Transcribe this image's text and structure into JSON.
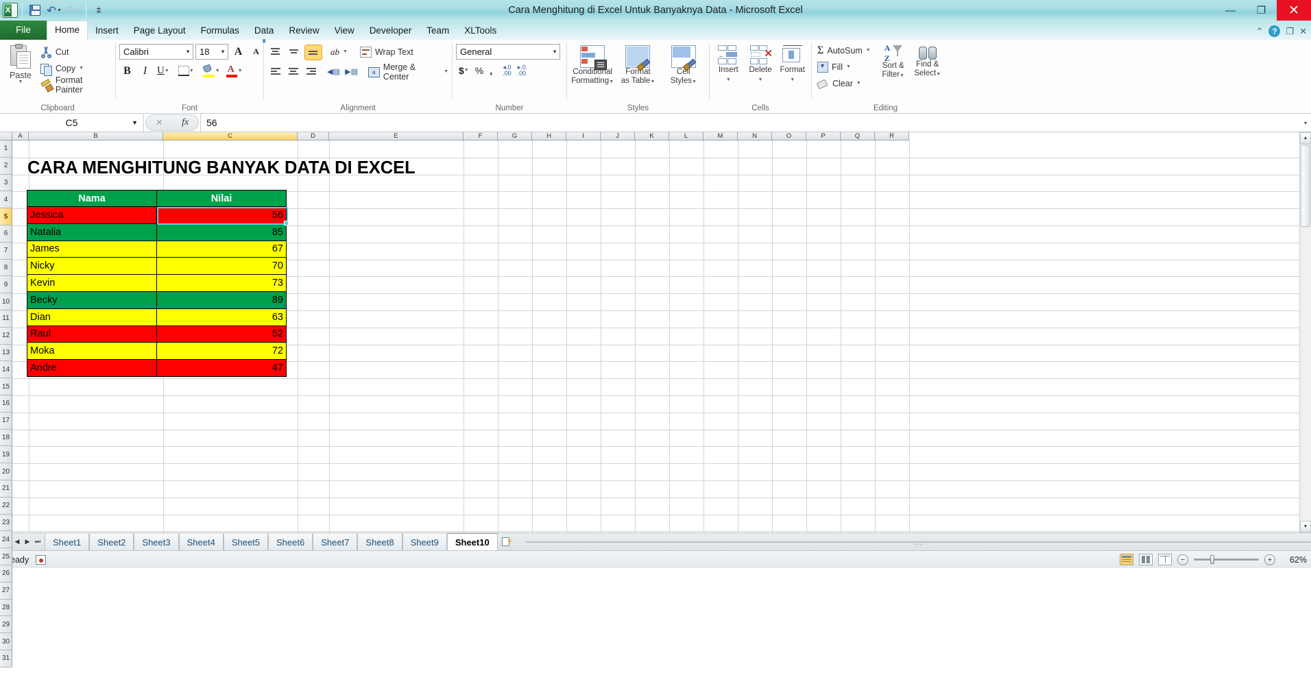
{
  "window": {
    "title": "Cara Menghitung di Excel Untuk Banyaknya Data - Microsoft Excel",
    "minimize": "—",
    "restore": "❐",
    "close": "✕"
  },
  "quick_access": {
    "logo": "excel-logo-icon",
    "save": "save-icon",
    "undo": "undo-icon",
    "redo": "redo-icon",
    "customize": "customize-qat-icon"
  },
  "ribbon_tabs": [
    {
      "label": "File",
      "active": false,
      "is_file": true
    },
    {
      "label": "Home",
      "active": true,
      "is_file": false
    },
    {
      "label": "Insert",
      "active": false,
      "is_file": false
    },
    {
      "label": "Page Layout",
      "active": false,
      "is_file": false
    },
    {
      "label": "Formulas",
      "active": false,
      "is_file": false
    },
    {
      "label": "Data",
      "active": false,
      "is_file": false
    },
    {
      "label": "Review",
      "active": false,
      "is_file": false
    },
    {
      "label": "View",
      "active": false,
      "is_file": false
    },
    {
      "label": "Developer",
      "active": false,
      "is_file": false
    },
    {
      "label": "Team",
      "active": false,
      "is_file": false
    },
    {
      "label": "XLTools",
      "active": false,
      "is_file": false
    }
  ],
  "ribbon_right": {
    "minimize_ribbon": "⌃",
    "help": "?",
    "restore_window": "❐",
    "close_window": "✕"
  },
  "ribbon": {
    "clipboard": {
      "label": "Clipboard",
      "paste": "Paste",
      "cut": "Cut",
      "copy": "Copy",
      "format_painter": "Format Painter"
    },
    "font": {
      "label": "Font",
      "font_name": "Calibri",
      "font_size": "18",
      "grow_font": "A",
      "shrink_font": "A",
      "bold": "B",
      "italic": "I",
      "underline": "U",
      "fill_color": "fill-color-icon",
      "font_color": "font-color-icon",
      "borders": "borders-icon"
    },
    "alignment": {
      "label": "Alignment",
      "wrap_text": "Wrap Text",
      "merge_center": "Merge & Center",
      "orientation": "orientation-icon"
    },
    "number": {
      "label": "Number",
      "format": "General",
      "currency": "$",
      "percent": "%",
      "comma": ",",
      "increase_decimal": ".00",
      "decrease_decimal": ".00"
    },
    "styles": {
      "label": "Styles",
      "conditional_formatting": "Conditional\nFormatting",
      "conditional_formatting_l1": "Conditional",
      "conditional_formatting_l2": "Formatting",
      "format_as_table_l1": "Format",
      "format_as_table_l2": "as Table",
      "cell_styles_l1": "Cell",
      "cell_styles_l2": "Styles"
    },
    "cells": {
      "label": "Cells",
      "insert": "Insert",
      "delete": "Delete",
      "format": "Format"
    },
    "editing": {
      "label": "Editing",
      "autosum": "AutoSum",
      "fill": "Fill",
      "clear": "Clear",
      "sort_filter_l1": "Sort &",
      "sort_filter_l2": "Filter",
      "find_select_l1": "Find &",
      "find_select_l2": "Select"
    }
  },
  "formula_bar": {
    "name_box": "C5",
    "cancel": "✕",
    "enter": "✓",
    "insert_function": "fx",
    "value": "56",
    "expand": "▾"
  },
  "grid": {
    "column_headers": [
      "A",
      "B",
      "C",
      "D",
      "E",
      "F",
      "G",
      "H",
      "I",
      "J",
      "K",
      "L",
      "M",
      "N",
      "O",
      "P",
      "Q",
      "R"
    ],
    "selected_column": "C",
    "row_headers": [
      "1",
      "2",
      "3",
      "4",
      "5",
      "6",
      "7",
      "8",
      "9",
      "10",
      "11",
      "12",
      "13",
      "14",
      "15",
      "16",
      "17",
      "18",
      "19",
      "20",
      "21",
      "22",
      "23",
      "24",
      "25",
      "26",
      "27",
      "28",
      "29",
      "30",
      "31"
    ],
    "selected_row": "5",
    "sheet_title": "CARA MENGHITUNG BANYAK DATA DI EXCEL",
    "table": {
      "headers": [
        "Nama",
        "Nilai"
      ],
      "rows": [
        {
          "name": "Jessica",
          "value": "56",
          "color": "red"
        },
        {
          "name": "Natalia",
          "value": "85",
          "color": "green"
        },
        {
          "name": "James",
          "value": "67",
          "color": "yellow"
        },
        {
          "name": "Nicky",
          "value": "70",
          "color": "yellow"
        },
        {
          "name": "Kevin",
          "value": "73",
          "color": "yellow"
        },
        {
          "name": "Becky",
          "value": "89",
          "color": "green"
        },
        {
          "name": "Dian",
          "value": "63",
          "color": "yellow"
        },
        {
          "name": "Raul",
          "value": "52",
          "color": "red"
        },
        {
          "name": "Moka",
          "value": "72",
          "color": "yellow"
        },
        {
          "name": "Andre",
          "value": "47",
          "color": "red"
        }
      ]
    },
    "colors": {
      "header_green": "#00a14b",
      "red": "#ff0000",
      "green": "#00a14b",
      "yellow": "#ffff00",
      "selection": "#4fd2e6"
    }
  },
  "sheet_tabs": {
    "first": "⏮",
    "prev": "◀",
    "next": "▶",
    "last": "⏭",
    "tabs": [
      {
        "label": "Sheet1",
        "active": false
      },
      {
        "label": "Sheet2",
        "active": false
      },
      {
        "label": "Sheet3",
        "active": false
      },
      {
        "label": "Sheet4",
        "active": false
      },
      {
        "label": "Sheet5",
        "active": false
      },
      {
        "label": "Sheet6",
        "active": false
      },
      {
        "label": "Sheet7",
        "active": false
      },
      {
        "label": "Sheet8",
        "active": false
      },
      {
        "label": "Sheet9",
        "active": false
      },
      {
        "label": "Sheet10",
        "active": true
      }
    ],
    "insert_sheet": "insert-worksheet-icon"
  },
  "status_bar": {
    "status": "Ready",
    "macro_record": "record-macro-icon",
    "view_normal": "normal-view-icon",
    "view_layout": "page-layout-view-icon",
    "view_break": "page-break-view-icon",
    "zoom_out": "−",
    "zoom_in": "+",
    "zoom_level": "62%"
  }
}
